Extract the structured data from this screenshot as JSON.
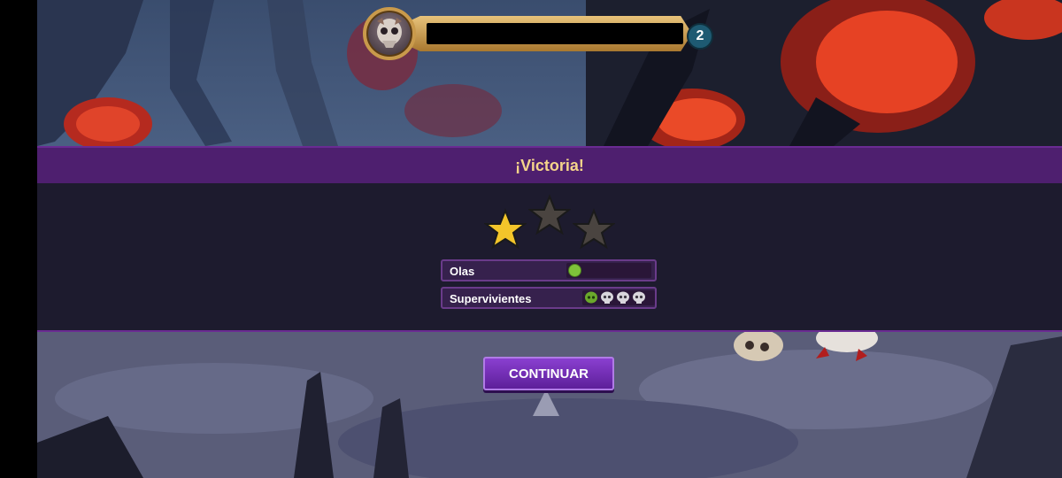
{
  "hud": {
    "level": "2",
    "level_color": "#1e5a72",
    "portrait_icon": "skull-creature-portrait",
    "health_bar_color": "#000000"
  },
  "modal": {
    "title": "¡Victoria!",
    "stars": {
      "earned": 1,
      "total": 3
    },
    "rows": [
      {
        "label": "Olas",
        "waves_progress": 0.15
      },
      {
        "label": "Supervivientes",
        "survivors": [
          "alive",
          "dead",
          "dead",
          "dead"
        ]
      }
    ]
  },
  "continue_button": {
    "label": "CONTINUAR"
  },
  "colors": {
    "modal_header": "#4e1f6f",
    "modal_body": "#1d1b2e",
    "star_gold": "#f3c52a",
    "star_empty": "#4a4440",
    "button_purple": "#7a33bf",
    "title_gold": "#f4d48a"
  }
}
